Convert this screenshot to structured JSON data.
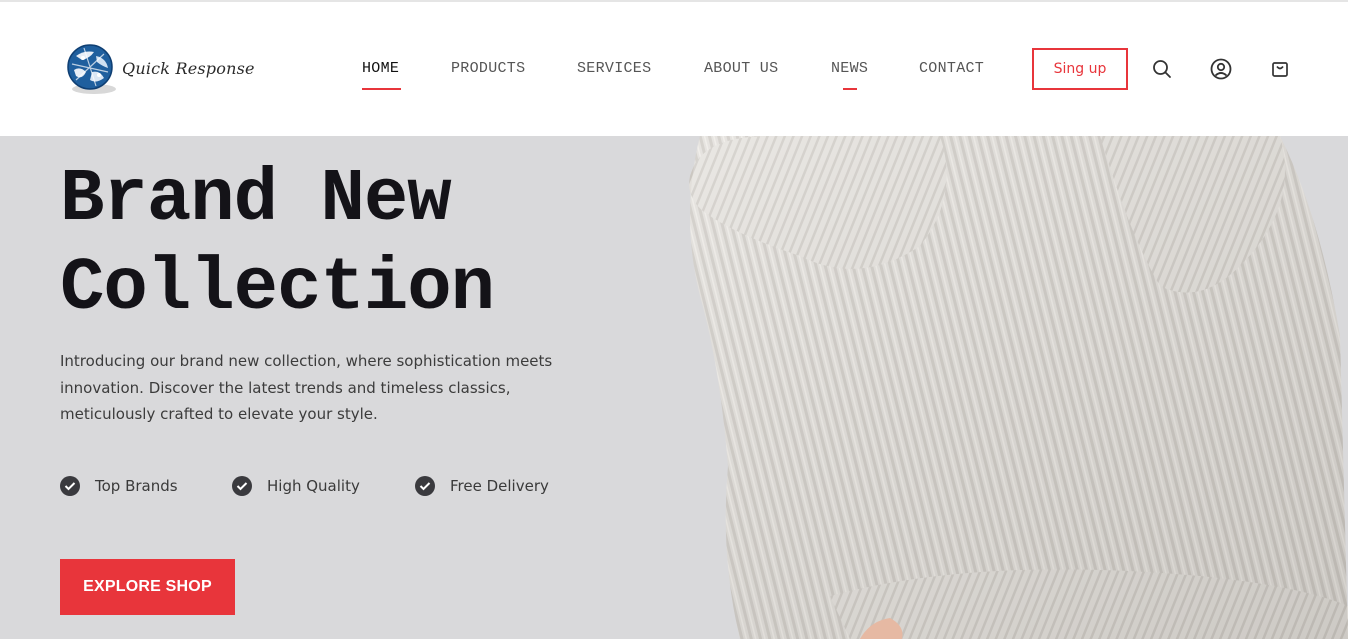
{
  "brand": {
    "name": "Quick Response",
    "logo_icon": "globe-icon"
  },
  "nav": {
    "items": [
      {
        "label": "HOME",
        "active": true
      },
      {
        "label": "PRODUCTS"
      },
      {
        "label": "SERVICES"
      },
      {
        "label": "ABOUT US"
      },
      {
        "label": "NEWS",
        "marker": true
      },
      {
        "label": "CONTACT"
      }
    ],
    "signup_label": "Sing up",
    "icons": [
      "search-icon",
      "user-icon",
      "cart-icon"
    ]
  },
  "hero": {
    "title_line1": "Brand New",
    "title_line2": "Collection",
    "description": "Introducing our brand new collection, where sophistication meets innovation. Discover the latest trends and timeless classics, meticulously crafted to elevate your style.",
    "features": [
      {
        "label": "Top Brands",
        "icon": "check-circle-icon"
      },
      {
        "label": "High Quality",
        "icon": "check-circle-icon"
      },
      {
        "label": "Free Delivery",
        "icon": "check-circle-icon"
      }
    ],
    "cta_label": "EXPLORE SHOP",
    "image": "knit-sweater-photo"
  },
  "colors": {
    "accent": "#e8353b",
    "hero_bg": "#d9d9db",
    "title": "#141318"
  }
}
